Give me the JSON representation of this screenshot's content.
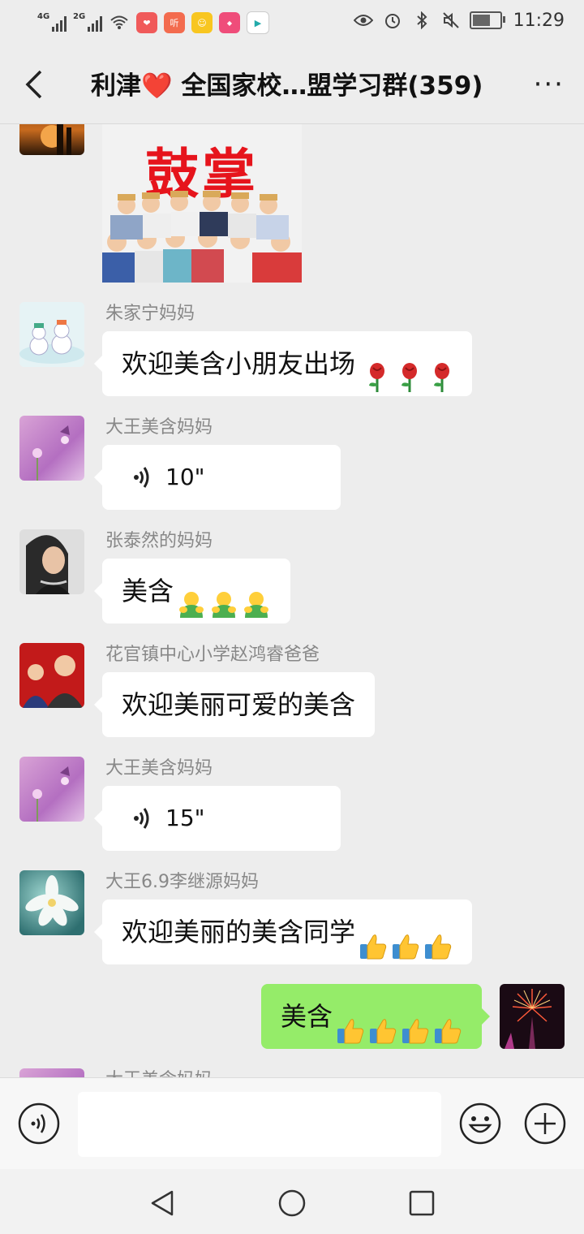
{
  "status_bar": {
    "net1": "4G",
    "net2": "2G",
    "app_icon_1": "听",
    "app_icon_2": "",
    "app_icon_3": "",
    "time": "11:29"
  },
  "header": {
    "title": "利津❤️ 全国家校…盟学习群(359)",
    "more": "···"
  },
  "messages": [
    {
      "sender": "朱家宁妈妈",
      "text": "欢迎美含小朋友出场"
    },
    {
      "sender": "大王美含妈妈",
      "voice_duration": "10\""
    },
    {
      "sender": "张泰然的妈妈",
      "text": "美含"
    },
    {
      "sender": "花官镇中心小学赵鸿睿爸爸",
      "text": "欢迎美丽可爱的美含"
    },
    {
      "sender": "大王美含妈妈",
      "voice_duration": "15\""
    },
    {
      "sender": "大王6.9李继源妈妈",
      "text": "欢迎美丽的美含同学"
    },
    {
      "sender": "me",
      "text": "美含"
    },
    {
      "sender": "大王美含妈妈",
      "text": ""
    }
  ],
  "sticker": {
    "caption": "鼓掌"
  },
  "colors": {
    "my_bubble": "#95ec69",
    "background": "#ededed",
    "sticker_text": "#e6141c"
  }
}
